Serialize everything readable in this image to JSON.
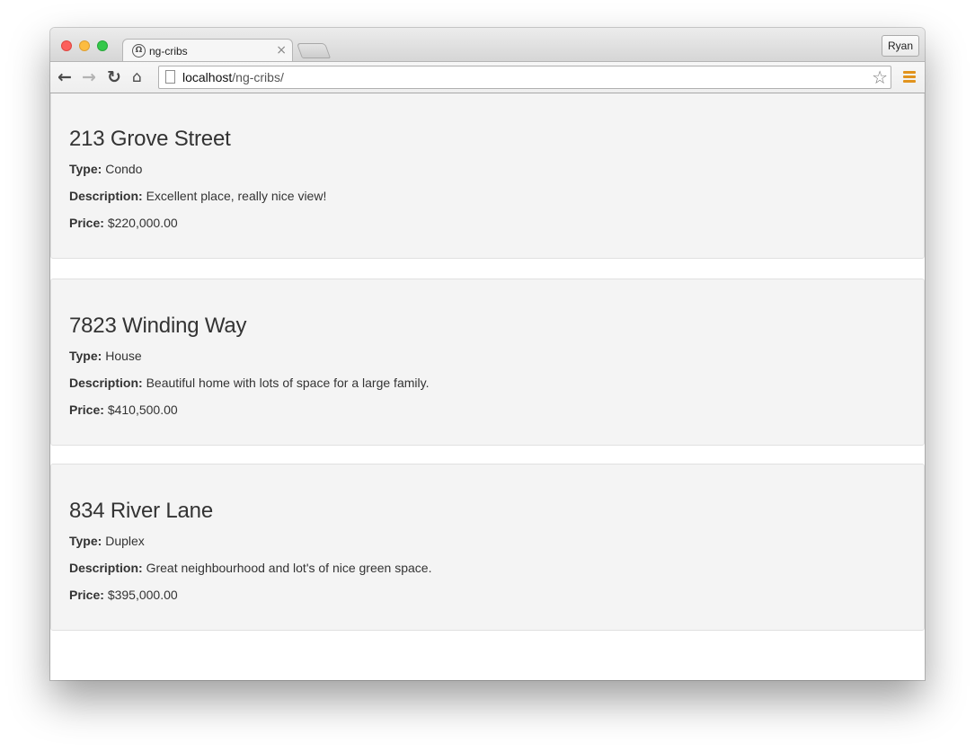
{
  "browser": {
    "tab_title": "ng-cribs",
    "tab_close": "×",
    "profile_name": "Ryan",
    "url_host": "localhost",
    "url_path": "/ng-cribs/"
  },
  "cribs": [
    {
      "address": "213 Grove Street",
      "type_label": "Type:",
      "type": "Condo",
      "description_label": "Description:",
      "description": "Excellent place, really nice view!",
      "price_label": "Price:",
      "price": "$220,000.00"
    },
    {
      "address": "7823 Winding Way",
      "type_label": "Type:",
      "type": "House",
      "description_label": "Description:",
      "description": "Beautiful home with lots of space for a large family.",
      "price_label": "Price:",
      "price": "$410,500.00"
    },
    {
      "address": "834 River Lane",
      "type_label": "Type:",
      "type": "Duplex",
      "description_label": "Description:",
      "description": "Great neighbourhood and lot's of nice green space.",
      "price_label": "Price:",
      "price": "$395,000.00"
    }
  ]
}
